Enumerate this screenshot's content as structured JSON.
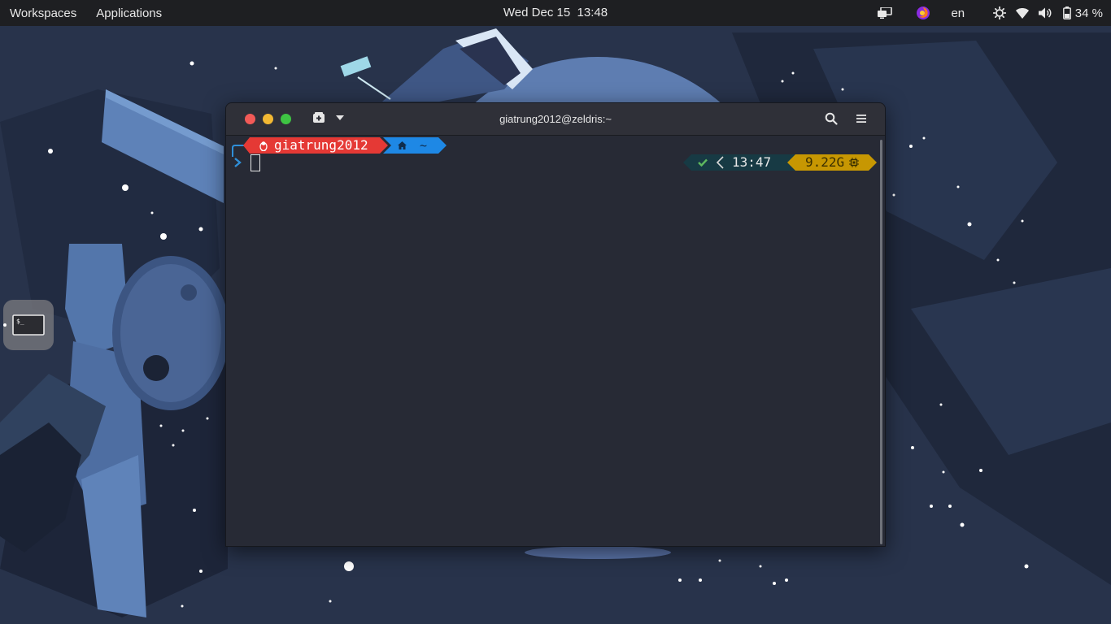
{
  "topbar": {
    "workspaces_label": "Workspaces",
    "applications_label": "Applications",
    "clock": "Wed Dec 15  13:48",
    "language": "en",
    "battery": "34 %"
  },
  "window": {
    "title": "giatrung2012@zeldris:~"
  },
  "prompt": {
    "user": "giatrung2012",
    "path": "~",
    "time": "13:47",
    "memory": "9.22G"
  },
  "colors": {
    "user_segment": "#e53935",
    "path_segment": "#1e88e5",
    "status_segment": "#134349",
    "memory_segment": "#c79702",
    "traffic_close": "#f25a57",
    "traffic_min": "#f2b833",
    "traffic_max": "#3ec443"
  },
  "icons": {
    "topbar": [
      "screen-share-icon",
      "firefox-icon",
      "brightness-icon",
      "wifi-icon",
      "volume-icon",
      "battery-icon"
    ],
    "headerbar": [
      "new-tab-icon",
      "chevron-down-icon",
      "search-icon",
      "hamburger-menu-icon"
    ],
    "prompt": [
      "linux-tux-icon",
      "home-icon",
      "check-icon",
      "cpu-icon"
    ],
    "dock": [
      "terminal-icon"
    ]
  }
}
